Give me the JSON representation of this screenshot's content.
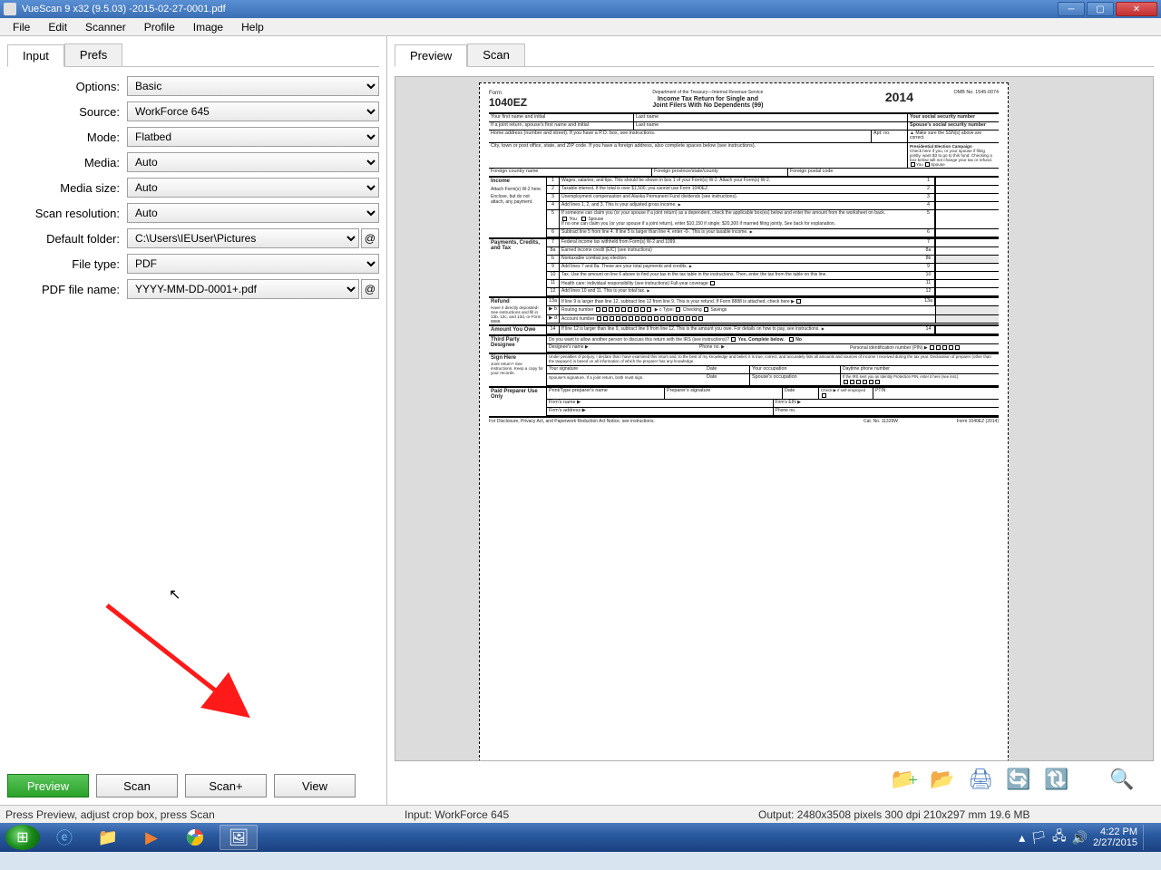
{
  "window": {
    "title": "VueScan 9 x32 (9.5.03) -2015-02-27-0001.pdf"
  },
  "menu": [
    "File",
    "Edit",
    "Scanner",
    "Profile",
    "Image",
    "Help"
  ],
  "left_tabs": {
    "input": "Input",
    "prefs": "Prefs"
  },
  "right_tabs": {
    "preview": "Preview",
    "scan": "Scan"
  },
  "options": {
    "options_label": "Options:",
    "options_value": "Basic",
    "source_label": "Source:",
    "source_value": "WorkForce 645",
    "mode_label": "Mode:",
    "mode_value": "Flatbed",
    "media_label": "Media:",
    "media_value": "Auto",
    "media_size_label": "Media size:",
    "media_size_value": "Auto",
    "scan_res_label": "Scan resolution:",
    "scan_res_value": "Auto",
    "default_folder_label": "Default folder:",
    "default_folder_value": "C:\\Users\\IEUser\\Pictures",
    "file_type_label": "File type:",
    "file_type_value": "PDF",
    "pdf_name_label": "PDF file name:",
    "pdf_name_value": "YYYY-MM-DD-0001+.pdf",
    "at_symbol": "@"
  },
  "buttons": {
    "preview": "Preview",
    "scan": "Scan",
    "scan_plus": "Scan+",
    "view": "View"
  },
  "status": {
    "left": "Press Preview, adjust crop box, press Scan",
    "mid": "Input: WorkForce 645",
    "right": "Output: 2480x3508 pixels 300 dpi 210x297 mm 19.6 MB"
  },
  "taskbar": {
    "time": "4:22 PM",
    "date": "2/27/2015"
  },
  "form": {
    "dept": "Department of the Treasury—Internal Revenue Service",
    "form_word": "Form",
    "form_num": "1040EZ",
    "title1": "Income Tax Return for Single and",
    "title2": "Joint Filers With No Dependents  (99)",
    "year": "2014",
    "omb": "OMB No. 1545-0074",
    "first_name": "Your first name and initial",
    "last_name": "Last name",
    "ssn": "Your social security number",
    "spouse_first": "If a joint return, spouse's first name and initial",
    "spouse_last": "Last name",
    "spouse_ssn": "Spouse's social security number",
    "home_addr": "Home address (number and street). If you have a P.O. box, see instructions.",
    "apt": "Apt. no.",
    "ssn_check": "▲ Make sure the SSN(s) above are correct.",
    "city": "City, town or post office, state, and ZIP code. If you have a foreign address, also complete spaces below (see instructions).",
    "pres_campaign": "Presidential Election Campaign",
    "pres_text": "Check here if you, or your spouse if filing jointly, want $3 to go to this fund. Checking a box below will not change your tax or refund.",
    "you": "You",
    "spouse": "Spouse",
    "foreign_country": "Foreign country name",
    "foreign_province": "Foreign province/state/county",
    "foreign_postal": "Foreign postal code",
    "sec_income": "Income",
    "attach_w2": "Attach Form(s) W-2 here.",
    "enclose": "Enclose, but do not attach, any payment.",
    "line1": "Wages, salaries, and tips. This should be shown in box 1 of your Form(s) W-2. Attach your Form(s) W-2.",
    "line2": "Taxable interest. If the total is over $1,500, you cannot use Form 1040EZ.",
    "line3": "Unemployment compensation and Alaska Permanent Fund dividends (see instructions).",
    "line4": "Add lines 1, 2, and 3. This is your adjusted gross income.",
    "line5a": "If someone can claim you (or your spouse if a joint return) as a dependent, check the applicable box(es) below and enter the amount from the worksheet on back.",
    "line5b": "If no one can claim you (or your spouse if a joint return), enter $10,150 if single; $20,300 if married filing jointly. See back for explanation.",
    "line6": "Subtract line 5 from line 4. If line 5 is larger than line 4, enter -0-. This is your taxable income.",
    "sec_payments": "Payments, Credits, and Tax",
    "line7": "Federal income tax withheld from Form(s) W-2 and 1099.",
    "line8a": "Earned income credit (EIC) (see instructions)",
    "line8b": "Nontaxable combat pay election.",
    "line9": "Add lines 7 and 8a. These are your total payments and credits.",
    "line10": "Tax. Use the amount on line 6 above to find your tax in the tax table in the instructions. Then, enter the tax from the table on this line.",
    "line11": "Health care: individual responsibility (see instructions)    Full-year coverage",
    "line12": "Add lines 10 and 11. This is your total tax.",
    "sec_refund": "Refund",
    "refund_sub": "Have it directly deposited! See instructions and fill in 13b, 13c, and 13d, or Form 8888.",
    "line13a": "If line 9 is larger than line 12, subtract line 12 from line 9. This is your refund. If Form 8888 is attached, check here ▶",
    "line13b": "Routing number",
    "line13c": "c Type:",
    "checking": "Checking",
    "savings": "Savings",
    "line13d": "Account number",
    "sec_owe": "Amount You Owe",
    "line14": "If line 12 is larger than line 9, subtract line 9 from line 12. This is the amount you owe. For details on how to pay, see instructions.",
    "sec_third": "Third Party Designee",
    "third_q": "Do you want to allow another person to discuss this return with the IRS (see instructions)?",
    "yes_complete": "Yes. Complete below.",
    "no": "No",
    "designee_name": "Designee's name ▶",
    "phone_no": "Phone no. ▶",
    "pin": "Personal identification number (PIN) ▶",
    "sec_sign": "Sign Here",
    "sign_joint": "Joint return? See instructions. Keep a copy for your records.",
    "sign_perjury": "Under penalties of perjury, I declare that I have examined this return and, to the best of my knowledge and belief, it is true, correct, and accurately lists all amounts and sources of income I received during the tax year. Declaration of preparer (other than the taxpayer) is based on all information of which the preparer has any knowledge.",
    "your_sig": "Your signature",
    "date": "Date",
    "your_occ": "Your occupation",
    "daytime_phone": "Daytime phone number",
    "spouse_sig": "Spouse's signature. If a joint return, both must sign.",
    "spouse_occ": "Spouse's occupation",
    "irs_pin": "If the IRS sent you an Identity Protection PIN, enter it here (see inst.)",
    "sec_paid": "Paid Preparer Use Only",
    "preparer_name": "Print/Type preparer's name",
    "preparer_sig": "Preparer's signature",
    "check_self": "Check ▶ if self-employed",
    "ptin": "PTIN",
    "firm_name": "Firm's name ▶",
    "firm_addr": "Firm's address ▶",
    "firm_ein": "Firm's EIN ▶",
    "firm_phone": "Phone no.",
    "disclosure": "For Disclosure, Privacy Act, and Paperwork Reduction Act Notice, see instructions.",
    "cat_no": "Cat. No. 11329W",
    "form_footer": "Form 1040EZ (2014)"
  }
}
